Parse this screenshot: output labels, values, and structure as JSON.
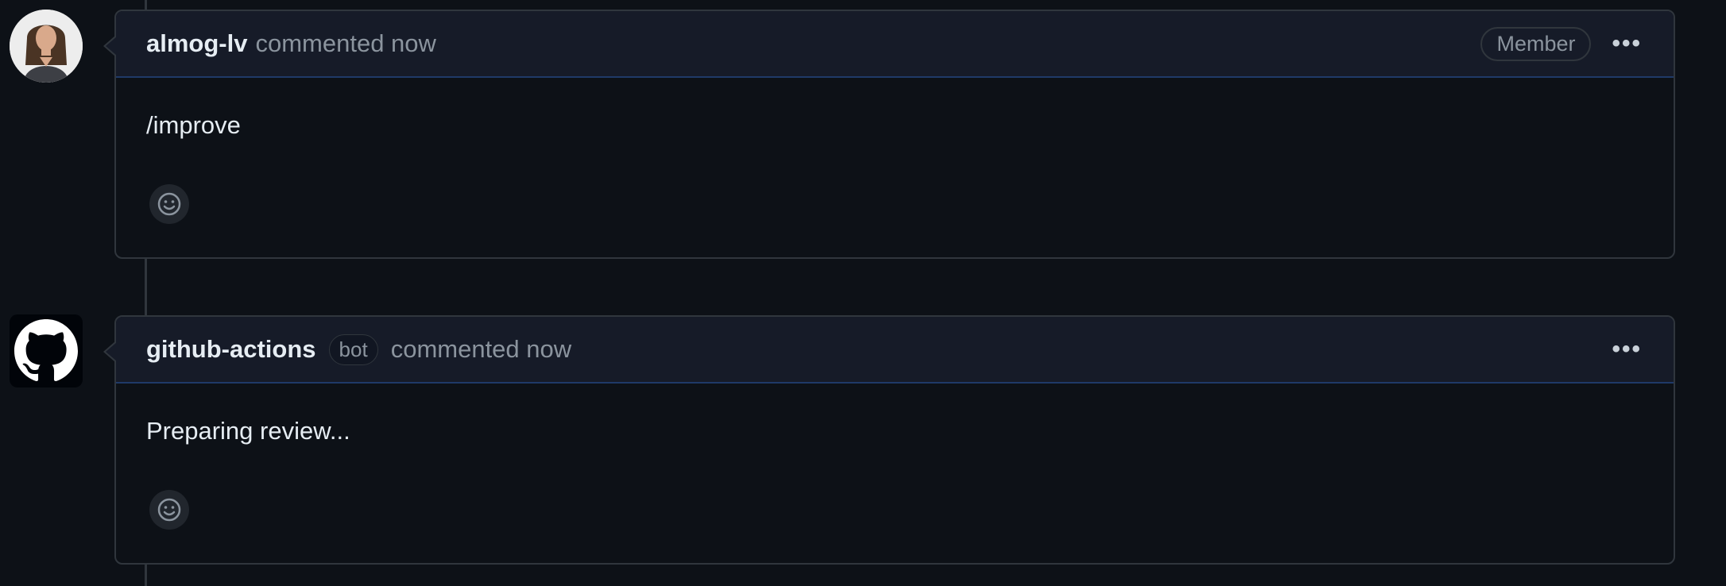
{
  "comments": [
    {
      "author": "almog-lv",
      "meta": "commented now",
      "role_badge": "Member",
      "body": "/improve",
      "avatar_icon": "user-avatar-photo",
      "more_icon": "kebab-horizontal-icon",
      "reaction_icon": "smiley-icon"
    },
    {
      "author": "github-actions",
      "bot_badge": "bot",
      "meta": "commented now",
      "body": "Preparing review...",
      "avatar_icon": "github-logo-icon",
      "more_icon": "kebab-horizontal-icon",
      "reaction_icon": "smiley-icon"
    }
  ],
  "colors": {
    "background": "#0d1117",
    "header_background": "#161b28",
    "border": "#30363d",
    "text": "#e6edf3",
    "muted_text": "#8b949e"
  }
}
